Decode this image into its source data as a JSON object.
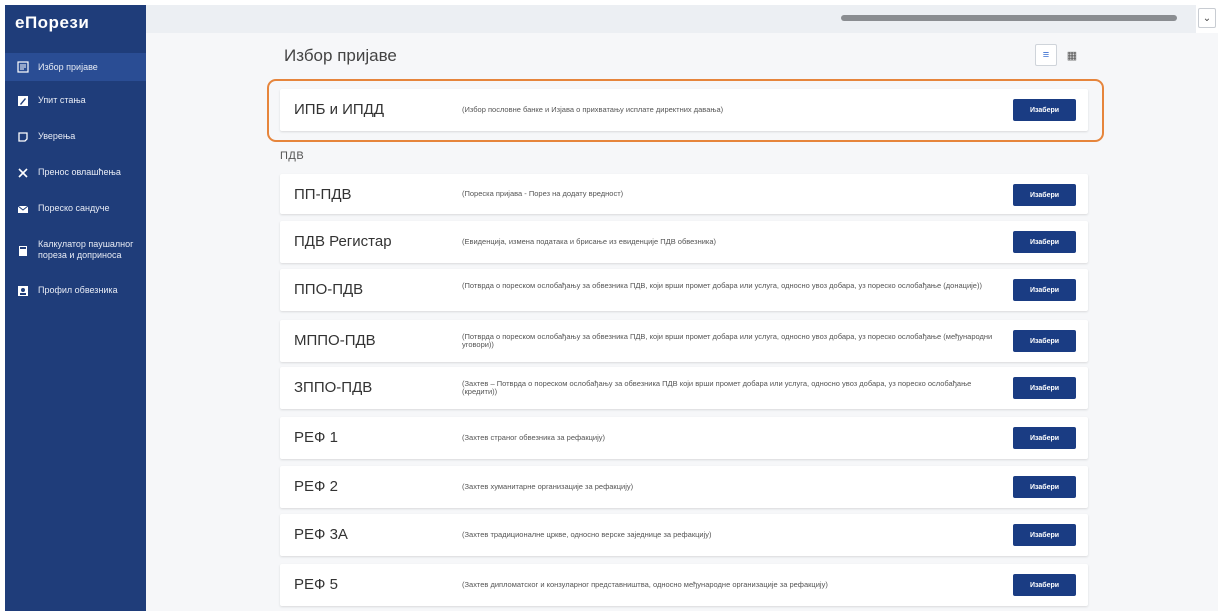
{
  "app": {
    "brand": "еПорези"
  },
  "sidebar": {
    "items": [
      {
        "label": "Избор пријаве",
        "icon": "form-icon"
      },
      {
        "label": "Упит стања",
        "icon": "pencil-icon"
      },
      {
        "label": "Уверења",
        "icon": "certificate-icon"
      },
      {
        "label": "Пренос овлашћења",
        "icon": "transfer-icon"
      },
      {
        "label": "Пореско сандуче",
        "icon": "mail-icon"
      },
      {
        "label": "Калкулатор паушалног пореза и доприноса",
        "icon": "calculator-icon"
      },
      {
        "label": "Профил обвезника",
        "icon": "profile-icon"
      }
    ]
  },
  "main": {
    "title": "Избор пријаве",
    "section": "ПДВ",
    "button_label": "Изабери",
    "rows": [
      {
        "code": "ИПБ и ИПДД",
        "desc": "(Избор пословне банке и Изјава о прихватању исплате директних давања)"
      },
      {
        "code": "ПП-ПДВ",
        "desc": "(Пореска пријава - Порез на додату вредност)"
      },
      {
        "code": "ПДВ Регистар",
        "desc": "(Евиденција, измена података и брисање из евиденције ПДВ обвезника)"
      },
      {
        "code": "ППО-ПДВ",
        "desc": "(Потврда о пореском ослобађању за обвезника ПДВ, који врши промет добара или услуга, односно увоз добара, уз пореско ослобађање (донације))"
      },
      {
        "code": "МППО-ПДВ",
        "desc": "(Потврда о пореском ослобађању за обвезника ПДВ, који врши промет добара или услуга, односно увоз добара, уз пореско ослобађање (међународни уговори))"
      },
      {
        "code": "ЗППО-ПДВ",
        "desc": "(Захтев – Потврда о пореском ослобађању за обвезника ПДВ који врши промет добара или услуга, односно увоз добара, уз пореско ослобађање (кредити))"
      },
      {
        "code": "РЕФ 1",
        "desc": "(Захтев страног обвезника за рефакцију)"
      },
      {
        "code": "РЕФ 2",
        "desc": "(Захтев хуманитарне организације за рефакцију)"
      },
      {
        "code": "РЕФ 3А",
        "desc": "(Захтев традиционалне цркве, односно верске заједнице за рефакцију)"
      },
      {
        "code": "РЕФ 5",
        "desc": "(Захтев дипломатског и конзуларног представништва, односно међународне организације за рефакцију)"
      }
    ]
  },
  "colors": {
    "sidebar": "#1f3d7a",
    "button": "#1a3c83",
    "highlight": "#e6853c"
  }
}
